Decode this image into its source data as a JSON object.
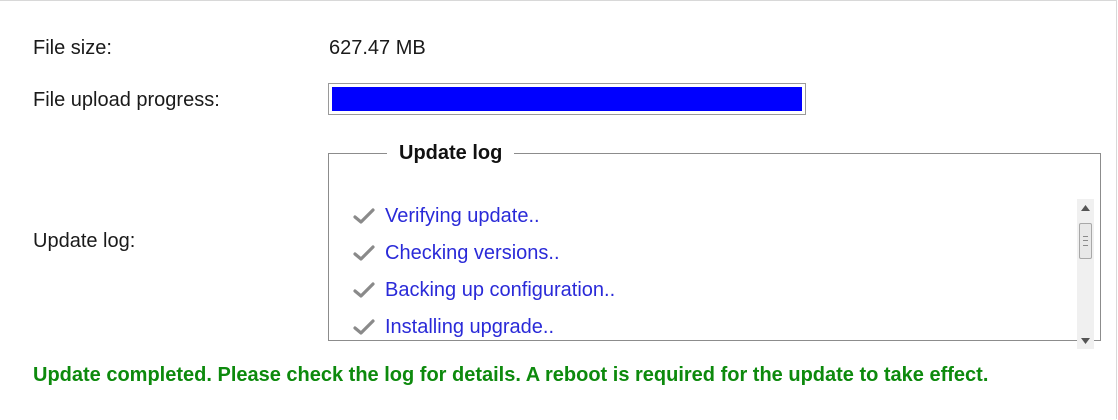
{
  "file_size": {
    "label": "File size:",
    "value": "627.47 MB"
  },
  "upload_progress": {
    "label": "File upload progress:",
    "percent": 100,
    "bar_color": "#0000ff"
  },
  "update_log": {
    "label": "Update log:",
    "legend": "Update log",
    "entries": [
      {
        "icon": "checkmark-icon",
        "text": "Verifying update.."
      },
      {
        "icon": "checkmark-icon",
        "text": "Checking versions.."
      },
      {
        "icon": "checkmark-icon",
        "text": "Backing up configuration.."
      },
      {
        "icon": "checkmark-icon",
        "text": "Installing upgrade.."
      }
    ],
    "entry_color": "#2a2ad8"
  },
  "status": {
    "message": "Update completed. Please check the log for details. A reboot is required for the update to take effect.",
    "color": "#0d8a0d"
  }
}
